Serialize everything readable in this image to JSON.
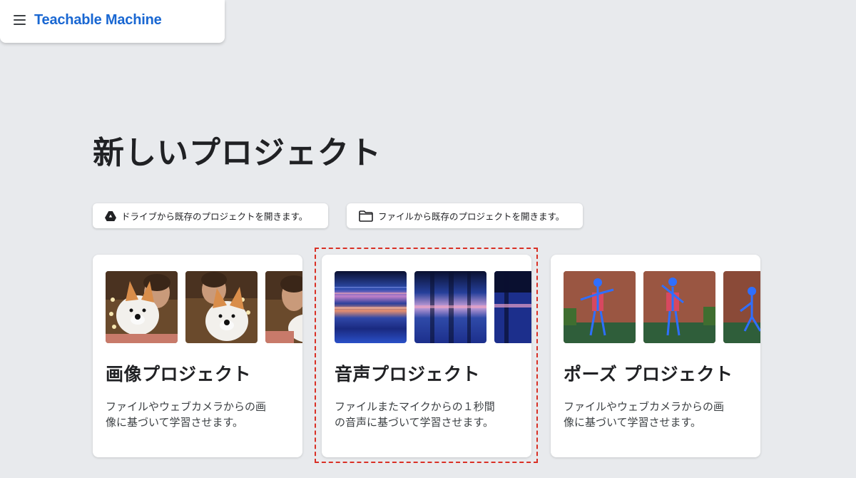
{
  "app": {
    "title": "Teachable Machine",
    "menu_icon": "hamburger-menu-icon",
    "brand_color": "#1967d2"
  },
  "page": {
    "title": "新しいプロジェクト",
    "background": "#e8eaed"
  },
  "open_actions": [
    {
      "label": "ドライブから既存のプロジェクトを開きます。",
      "icon": "google-drive-icon"
    },
    {
      "label": "ファイルから既存のプロジェクトを開きます。",
      "icon": "folder-icon"
    }
  ],
  "project_cards": [
    {
      "title": "画像プロジェクト",
      "description": "ファイルやウェブカメラからの画\n像に基づいて学習させます。",
      "thumbnail_type": "photos-of-plush-dog"
    },
    {
      "title": "音声プロジェクト",
      "description": "ファイルまたマイクからの１秒間\nの音声に基づいて学習させます。",
      "thumbnail_type": "audio-spectrograms",
      "highlighted": true
    },
    {
      "title": "ポーズ プロジェクト",
      "description": "ファイルやウェブカメラからの画\n像に基づいて学習させます。",
      "thumbnail_type": "pose-skeleton-photos"
    }
  ],
  "highlight_color": "#d93025"
}
